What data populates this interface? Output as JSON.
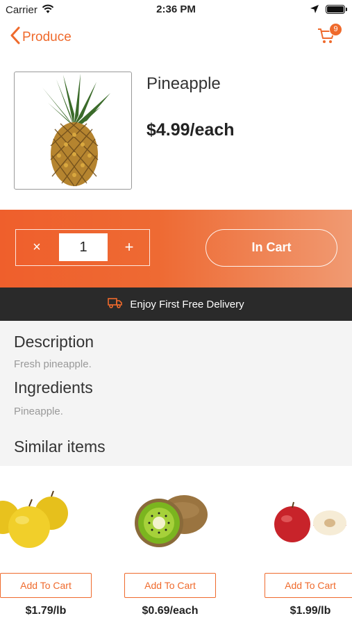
{
  "status_bar": {
    "carrier": "Carrier",
    "time": "2:36 PM"
  },
  "nav": {
    "back_label": "Produce",
    "cart_count": "9"
  },
  "product": {
    "name": "Pineapple",
    "price": "$4.99/each"
  },
  "cart_controls": {
    "minus": "×",
    "quantity": "1",
    "plus": "+",
    "in_cart_label": "In Cart"
  },
  "delivery_banner": {
    "text": "Enjoy First Free Delivery"
  },
  "details": {
    "description_heading": "Description",
    "description_text": "Fresh pineapple.",
    "ingredients_heading": "Ingredients",
    "ingredients_text": "Pineapple.",
    "similar_heading": "Similar items"
  },
  "similar_items": [
    {
      "image": "golden-apples",
      "button": "Add To Cart",
      "price": "$1.79/lb"
    },
    {
      "image": "kiwi",
      "button": "Add To Cart",
      "price": "$0.69/each"
    },
    {
      "image": "red-apples",
      "button": "Add To Cart",
      "price": "$1.99/lb"
    }
  ],
  "colors": {
    "accent": "#ef6a2c",
    "banner_dark": "#2a2a2a",
    "info_bg": "#f4f4f4"
  }
}
